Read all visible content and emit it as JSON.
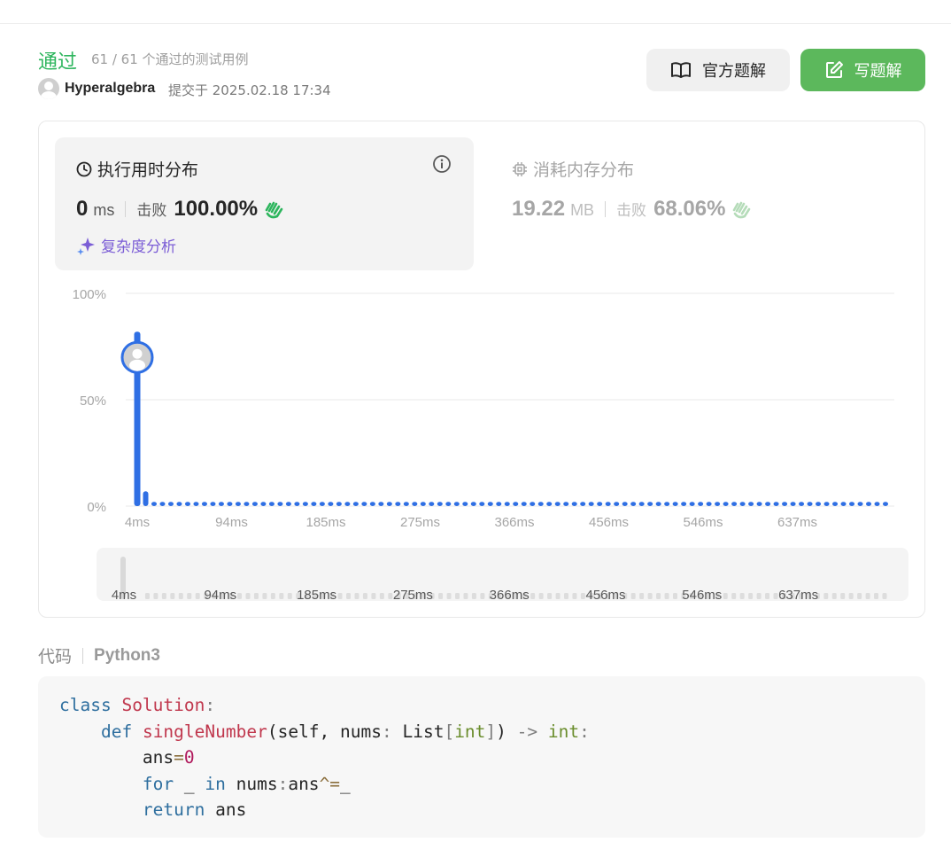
{
  "submission": {
    "status": "通过",
    "testcases": "61 / 61 个通过的测试用例",
    "username": "Hyperalgebra",
    "submitted_at": "提交于 2025.02.18 17:34"
  },
  "buttons": {
    "official_solution": "官方题解",
    "write_solution": "写题解"
  },
  "runtime": {
    "title": "执行用时分布",
    "value": "0",
    "unit": "ms",
    "beat_label": "击败",
    "beat_pct": "100.00%",
    "complexity_link": "复杂度分析"
  },
  "memory": {
    "title": "消耗内存分布",
    "value": "19.22",
    "unit": "MB",
    "beat_label": "击败",
    "beat_pct": "68.06%"
  },
  "colors": {
    "accent_green": "#2db55d",
    "button_green": "#5cb85c",
    "bar_blue": "#2f6fe4",
    "complexity_purple": "#7b5dd6"
  },
  "chart_data": {
    "type": "bar",
    "x": [
      "4ms",
      "94ms",
      "185ms",
      "275ms",
      "366ms",
      "456ms",
      "546ms",
      "637ms"
    ],
    "values": [
      82,
      7,
      2,
      2,
      2,
      2,
      2,
      2,
      2,
      2,
      2,
      2,
      2,
      2,
      2,
      2,
      2,
      2,
      2,
      2,
      2,
      2,
      2,
      2,
      2,
      2,
      2,
      2,
      2,
      2,
      2,
      2,
      2,
      2,
      2,
      2,
      2,
      2,
      2,
      2,
      2,
      2,
      2,
      2,
      2,
      2,
      2,
      2,
      2,
      2,
      2,
      2,
      2,
      2,
      2,
      2,
      2,
      2,
      2,
      2,
      2,
      2,
      2,
      2,
      2,
      2,
      2,
      2,
      2,
      2,
      2,
      2,
      2,
      2,
      2,
      2,
      2,
      2,
      2,
      2,
      2,
      2,
      2,
      2,
      2,
      2,
      2,
      2,
      2,
      2
    ],
    "yticks": [
      "100%",
      "50%",
      "0%"
    ],
    "ylim": [
      0,
      100
    ],
    "highlight_index": 0,
    "grid": true
  },
  "overview_ticks": [
    "4ms",
    "94ms",
    "185ms",
    "275ms",
    "366ms",
    "456ms",
    "546ms",
    "637ms"
  ],
  "code": {
    "label": "代码",
    "language": "Python3"
  }
}
